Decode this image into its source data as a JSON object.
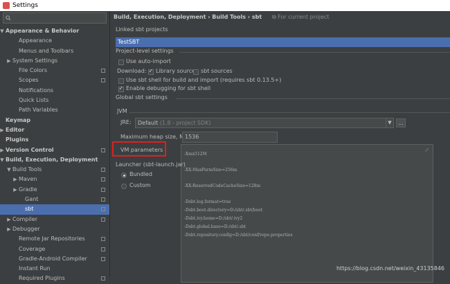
{
  "window": {
    "title": "Settings"
  },
  "sidebar": {
    "items": [
      {
        "label": "Appearance & Behavior",
        "level": 0,
        "arrow": "▼",
        "bold": true,
        "copy": false,
        "selected": false
      },
      {
        "label": "Appearance",
        "level": 2,
        "arrow": "",
        "bold": false,
        "copy": false,
        "selected": false
      },
      {
        "label": "Menus and Toolbars",
        "level": 2,
        "arrow": "",
        "bold": false,
        "copy": false,
        "selected": false
      },
      {
        "label": "System Settings",
        "level": 1,
        "arrow": "▶",
        "bold": false,
        "copy": false,
        "selected": false
      },
      {
        "label": "File Colors",
        "level": 2,
        "arrow": "",
        "bold": false,
        "copy": true,
        "selected": false
      },
      {
        "label": "Scopes",
        "level": 2,
        "arrow": "",
        "bold": false,
        "copy": true,
        "selected": false
      },
      {
        "label": "Notifications",
        "level": 2,
        "arrow": "",
        "bold": false,
        "copy": false,
        "selected": false
      },
      {
        "label": "Quick Lists",
        "level": 2,
        "arrow": "",
        "bold": false,
        "copy": false,
        "selected": false
      },
      {
        "label": "Path Variables",
        "level": 2,
        "arrow": "",
        "bold": false,
        "copy": false,
        "selected": false
      },
      {
        "label": "Keymap",
        "level": 0,
        "arrow": "",
        "bold": true,
        "copy": false,
        "selected": false
      },
      {
        "label": "Editor",
        "level": 0,
        "arrow": "▶",
        "bold": true,
        "copy": false,
        "selected": false
      },
      {
        "label": "Plugins",
        "level": 0,
        "arrow": "",
        "bold": true,
        "copy": false,
        "selected": false
      },
      {
        "label": "Version Control",
        "level": 0,
        "arrow": "▶",
        "bold": true,
        "copy": true,
        "selected": false
      },
      {
        "label": "Build, Execution, Deployment",
        "level": 0,
        "arrow": "▼",
        "bold": true,
        "copy": false,
        "selected": false
      },
      {
        "label": "Build Tools",
        "level": 1,
        "arrow": "▼",
        "bold": false,
        "copy": true,
        "selected": false
      },
      {
        "label": "Maven",
        "level": 2,
        "arrow": "▶",
        "bold": false,
        "copy": true,
        "selected": false
      },
      {
        "label": "Gradle",
        "level": 2,
        "arrow": "▶",
        "bold": false,
        "copy": true,
        "selected": false
      },
      {
        "label": "Gant",
        "level": 3,
        "arrow": "",
        "bold": false,
        "copy": true,
        "selected": false
      },
      {
        "label": "sbt",
        "level": 3,
        "arrow": "",
        "bold": false,
        "copy": true,
        "selected": true
      },
      {
        "label": "Compiler",
        "level": 1,
        "arrow": "▶",
        "bold": false,
        "copy": true,
        "selected": false
      },
      {
        "label": "Debugger",
        "level": 1,
        "arrow": "▶",
        "bold": false,
        "copy": false,
        "selected": false
      },
      {
        "label": "Remote Jar Repositories",
        "level": 2,
        "arrow": "",
        "bold": false,
        "copy": true,
        "selected": false
      },
      {
        "label": "Coverage",
        "level": 2,
        "arrow": "",
        "bold": false,
        "copy": true,
        "selected": false
      },
      {
        "label": "Gradle-Android Compiler",
        "level": 2,
        "arrow": "",
        "bold": false,
        "copy": true,
        "selected": false
      },
      {
        "label": "Instant Run",
        "level": 2,
        "arrow": "",
        "bold": false,
        "copy": false,
        "selected": false
      },
      {
        "label": "Required Plugins",
        "level": 2,
        "arrow": "",
        "bold": false,
        "copy": true,
        "selected": false
      }
    ]
  },
  "breadcrumb": {
    "path": "Build, Execution, Deployment › Build Tools › sbt",
    "hint": "For current project"
  },
  "linked": {
    "label": "Linked sbt projects",
    "project": "TestSBT"
  },
  "project_level": {
    "label": "Project-level settings",
    "auto_import": "Use auto-import",
    "download_label": "Download:",
    "library_sources": "Library sources",
    "sbt_sources": "sbt sources",
    "sbt_shell": "Use sbt shell for build and import (requires sbt 0.13.5+)",
    "debugging": "Enable debugging for sbt shell"
  },
  "global": {
    "label": "Global sbt settings",
    "jvm_label": "JVM",
    "jre_label": "JRE:",
    "jre_value": "Default",
    "jre_sdk": "(1.8 - project SDK)",
    "jre_button": "...",
    "heap_label": "Maximum heap size, MB",
    "heap_value": "1536",
    "vm_label": "VM parameters",
    "vm_lines": [
      "-Xmx512M",
      "-XX:MaxPermSize=256m",
      "-XX:ReservedCodeCacheSize=128m",
      "-Dsbt.log.format=true",
      "-Dsbt.boot.directory=D:/sbt/.sbt/boot",
      "-Dsbt.ivy.home=D:/sbt/.ivy2",
      "-Dsbt.global.base=D:/sbt/.sbt",
      "-Dsbt.repository.config=D:/sbt/conf/repo.properties"
    ],
    "launcher_label": "Launcher (sbt-launch.jar)",
    "bundled": "Bundled",
    "custom": "Custom"
  },
  "watermark": "https://blog.csdn.net/weixin_43135846"
}
